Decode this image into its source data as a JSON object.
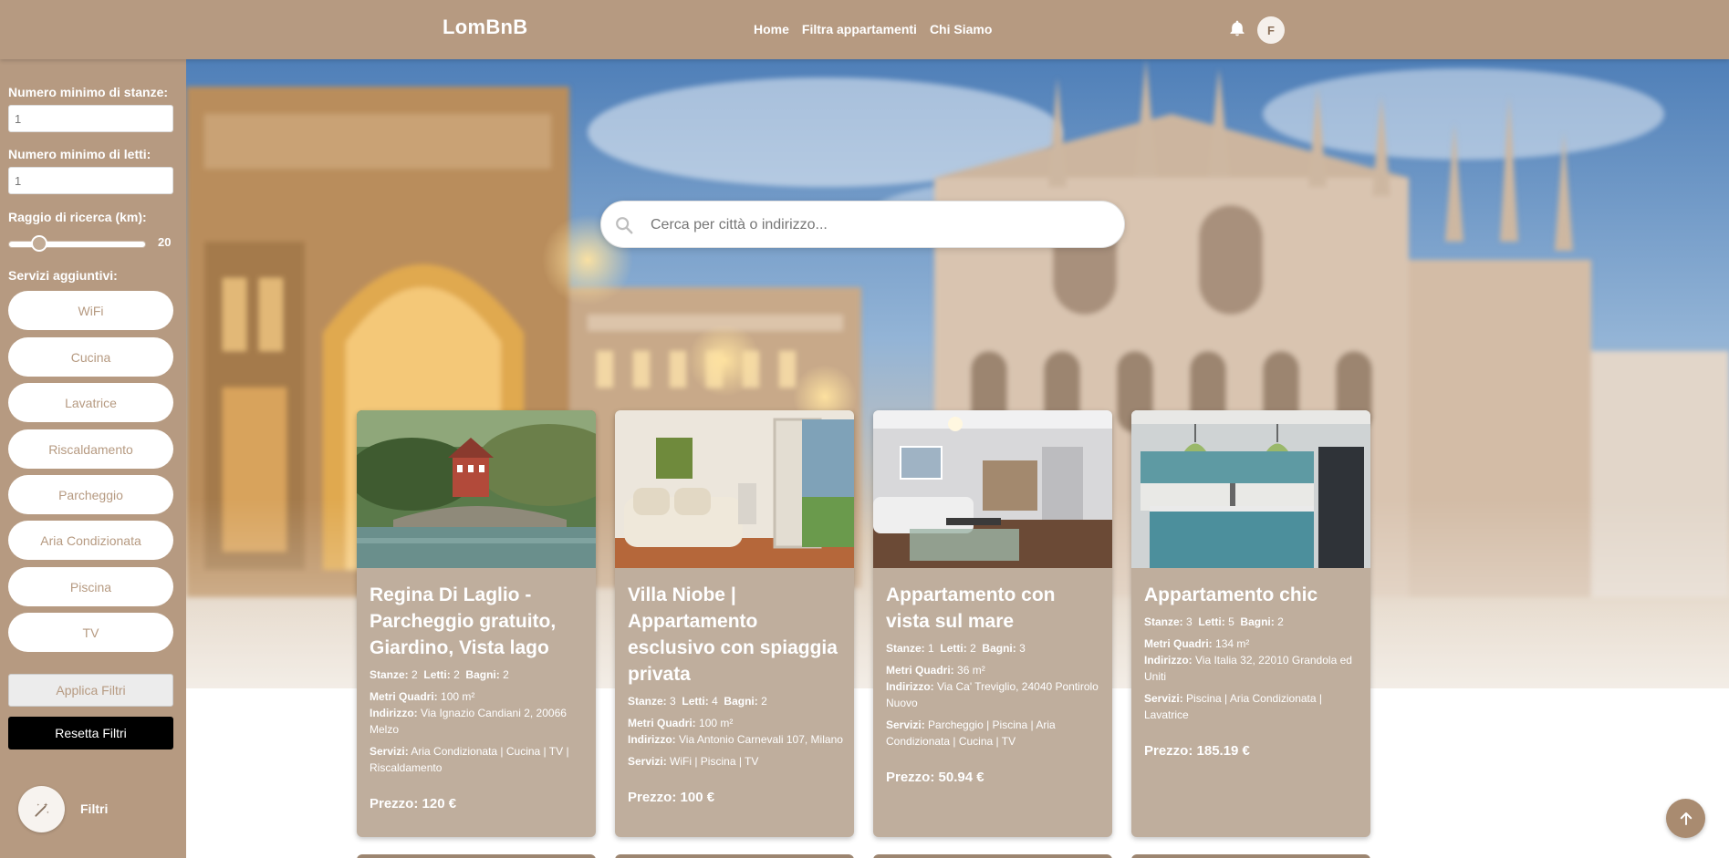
{
  "header": {
    "brand": "LomBnB",
    "nav": [
      "Home",
      "Filtra appartamenti",
      "Chi Siamo"
    ],
    "avatar_initial": "F"
  },
  "sidebar": {
    "rooms_label": "Numero minimo di stanze:",
    "rooms_value": "1",
    "beds_label": "Numero minimo di letti:",
    "beds_value": "1",
    "radius_label": "Raggio di ricerca (km):",
    "radius_value": "20",
    "services_label": "Servizi aggiuntivi:",
    "services": [
      "WiFi",
      "Cucina",
      "Lavatrice",
      "Riscaldamento",
      "Parcheggio",
      "Aria Condizionata",
      "Piscina",
      "TV"
    ],
    "apply_label": "Applica Filtri",
    "reset_label": "Resetta Filtri",
    "filters_toggle_label": "Filtri"
  },
  "search": {
    "placeholder": "Cerca per città o indirizzo..."
  },
  "labels": {
    "rooms": "Stanze:",
    "beds": "Letti:",
    "baths": "Bagni:",
    "sqm": "Metri Quadri:",
    "address": "Indirizzo:",
    "services": "Servizi:",
    "price": "Prezzo:"
  },
  "listings": [
    {
      "title": "Regina Di Laglio - Parcheggio gratuito, Giardino, Vista lago",
      "rooms": "2",
      "beds": "2",
      "baths": "2",
      "sqm": "100 m²",
      "address": "Via Ignazio Candiani 2, 20066 Melzo",
      "services": "Aria Condizionata | Cucina | TV | Riscaldamento",
      "price": "120 €"
    },
    {
      "title": "Villa Niobe | Appartamento esclusivo con spiaggia privata",
      "rooms": "3",
      "beds": "4",
      "baths": "2",
      "sqm": "100 m²",
      "address": "Via Antonio Carnevali 107, Milano",
      "services": "WiFi | Piscina | TV",
      "price": "100 €"
    },
    {
      "title": "Appartamento con vista sul mare",
      "rooms": "1",
      "beds": "2",
      "baths": "3",
      "sqm": "36 m²",
      "address": "Via Ca' Treviglio, 24040 Pontirolo Nuovo",
      "services": "Parcheggio | Piscina | Aria Condizionata | Cucina | TV",
      "price": "50.94 €"
    },
    {
      "title": "Appartamento chic",
      "rooms": "3",
      "beds": "5",
      "baths": "2",
      "sqm": "134 m²",
      "address": "Via Italia 32, 22010 Grandola ed Uniti",
      "services": "Piscina | Aria Condizionata | Lavatrice",
      "price": "185.19 €"
    }
  ],
  "icons": {
    "bell": "bell-icon",
    "search": "search-icon",
    "wand": "magic-wand-icon",
    "scroll_top": "arrow-up-icon"
  },
  "colors": {
    "brand": "#b69a81",
    "card": "#bfae9d",
    "reset_button": "#000000"
  }
}
